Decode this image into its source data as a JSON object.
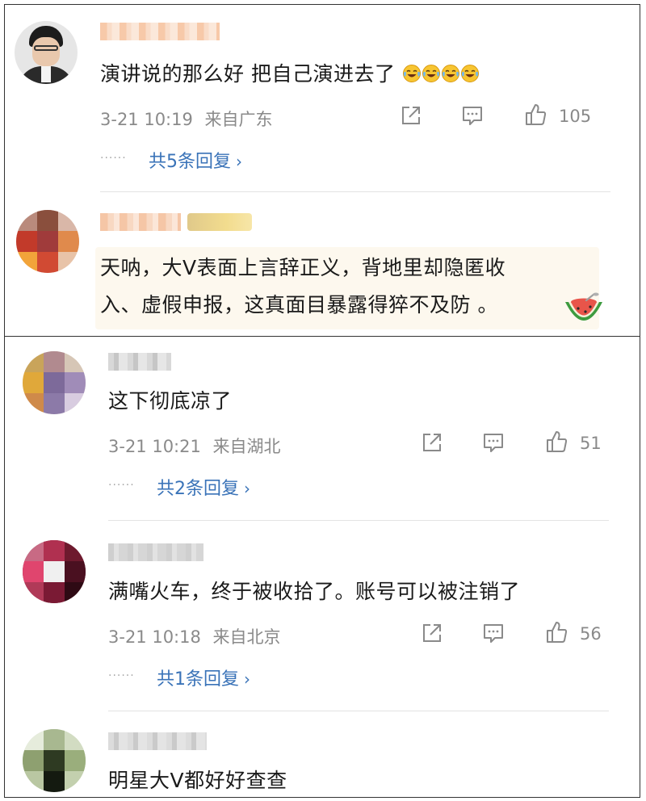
{
  "comments": [
    {
      "text": "演讲说的那么好  把自己演进去了",
      "emojis": [
        "crying-laughing",
        "crying-laughing",
        "crying-laughing",
        "crying-laughing"
      ],
      "date": "3-21 10:19",
      "location": "来自广东",
      "likes": "105",
      "replies": "共5条回复"
    },
    {
      "text_line1": "天呐，大V表面上言辞正义，背地里却隐匿收",
      "text_line2": "入、虚假申报，这真面目暴露得猝不及防 。",
      "sticker": "watermelon"
    },
    {
      "text": "这下彻底凉了",
      "date": "3-21 10:21",
      "location": "来自湖北",
      "likes": "51",
      "replies": "共2条回复"
    },
    {
      "text": "满嘴火车，终于被收拾了。账号可以被注销了",
      "date": "3-21 10:18",
      "location": "来自北京",
      "likes": "56",
      "replies": "共1条回复"
    },
    {
      "text": "明星大V都好好查查"
    }
  ],
  "icons": {
    "share": "share-icon",
    "comment": "comment-icon",
    "like": "thumbs-up-icon",
    "chevron": "chevron-right-icon"
  },
  "colors": {
    "meta_gray": "#8a8a8a",
    "link_blue": "#3a73b8",
    "panel_border": "#333333"
  },
  "reply_dots": "······",
  "chevron_glyph": "›"
}
